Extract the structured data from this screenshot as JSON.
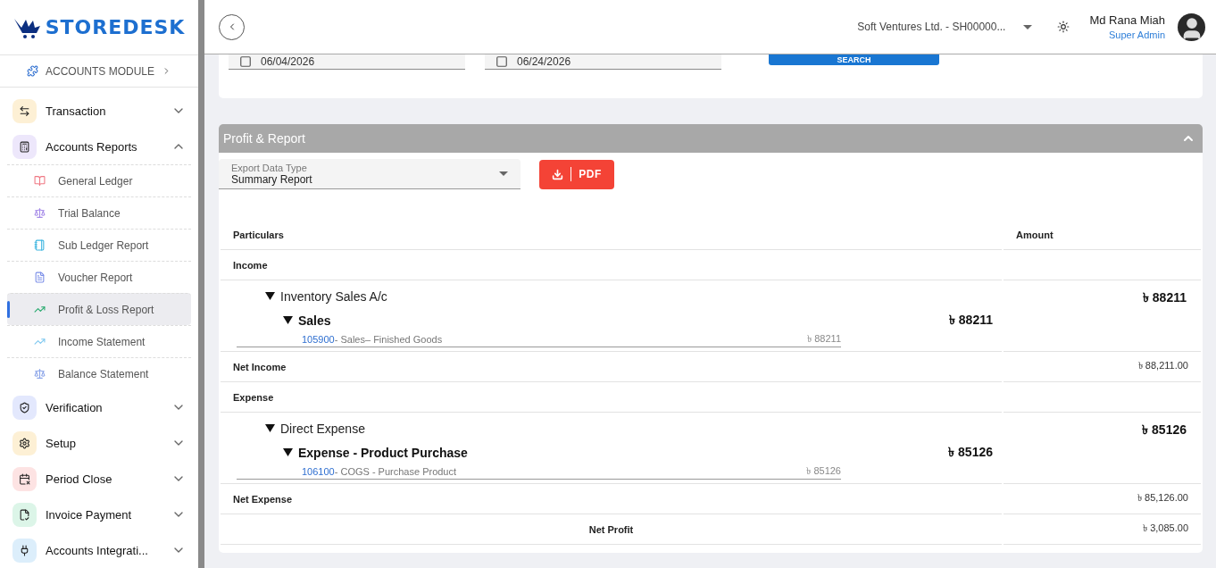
{
  "sidebar": {
    "brand": "STOREDESK",
    "module": "ACCOUNTS MODULE",
    "items": [
      {
        "label": "Transaction",
        "expanded": false,
        "color": "#fdf0d5"
      },
      {
        "label": "Accounts Reports",
        "expanded": true,
        "color": "#ede7fb",
        "children": [
          {
            "label": "General Ledger",
            "selected": false
          },
          {
            "label": "Trial Balance",
            "selected": false
          },
          {
            "label": "Sub Ledger Report",
            "selected": false
          },
          {
            "label": "Voucher Report",
            "selected": false
          },
          {
            "label": "Profit & Loss Report",
            "selected": true
          },
          {
            "label": "Income Statement",
            "selected": false
          },
          {
            "label": "Balance Statement",
            "selected": false
          }
        ]
      },
      {
        "label": "Verification",
        "expanded": false,
        "color": "#e3e8fd"
      },
      {
        "label": "Setup",
        "expanded": false,
        "color": "#fdf0d5"
      },
      {
        "label": "Period Close",
        "expanded": false,
        "color": "#fde3e3"
      },
      {
        "label": "Invoice Payment",
        "expanded": false,
        "color": "#dcf5e8"
      },
      {
        "label": "Accounts Integrati...",
        "expanded": false,
        "color": "#dceefb"
      }
    ]
  },
  "header": {
    "company": "Soft Ventures Ltd. - SH00000...",
    "user_name": "Md Rana Miah",
    "user_role": "Super Admin"
  },
  "filters": {
    "from_date": "06/04/2026",
    "to_date": "06/24/2026",
    "search_button": "SEARCH"
  },
  "report": {
    "title": "Profit & Report",
    "expanded": true,
    "export": {
      "label": "Export Data Type",
      "value": "Summary Report"
    },
    "pdf_button": "PDF",
    "columns": [
      "Particulars",
      "Amount"
    ],
    "rows": [
      {
        "kind": "section",
        "label": "Income"
      },
      {
        "kind": "group",
        "label": "Inventory Sales A/c",
        "amount": "৳ 88211",
        "expanded": true,
        "children": [
          {
            "label": "Sales",
            "amount": "৳ 88211",
            "expanded": true,
            "children": [
              {
                "code": "105900",
                "name": " - Sales– Finished Goods",
                "amount": "৳ 88211"
              }
            ]
          }
        ]
      },
      {
        "kind": "total",
        "label": "Net Income",
        "amount": "৳ 88,211.00"
      },
      {
        "kind": "section",
        "label": "Expense"
      },
      {
        "kind": "group",
        "label": "Direct Expense",
        "amount": "৳ 85126",
        "expanded": true,
        "children": [
          {
            "label": "Expense - Product Purchase",
            "amount": "৳ 85126",
            "expanded": true,
            "children": [
              {
                "code": "106100",
                "name": " - COGS - Purchase Product",
                "amount": "৳ 85126"
              }
            ]
          }
        ]
      },
      {
        "kind": "total",
        "label": "Net Expense",
        "amount": "৳ 85,126.00"
      },
      {
        "kind": "result",
        "result_label": "Net Profit",
        "amount": "৳ 3,085.00"
      }
    ]
  }
}
